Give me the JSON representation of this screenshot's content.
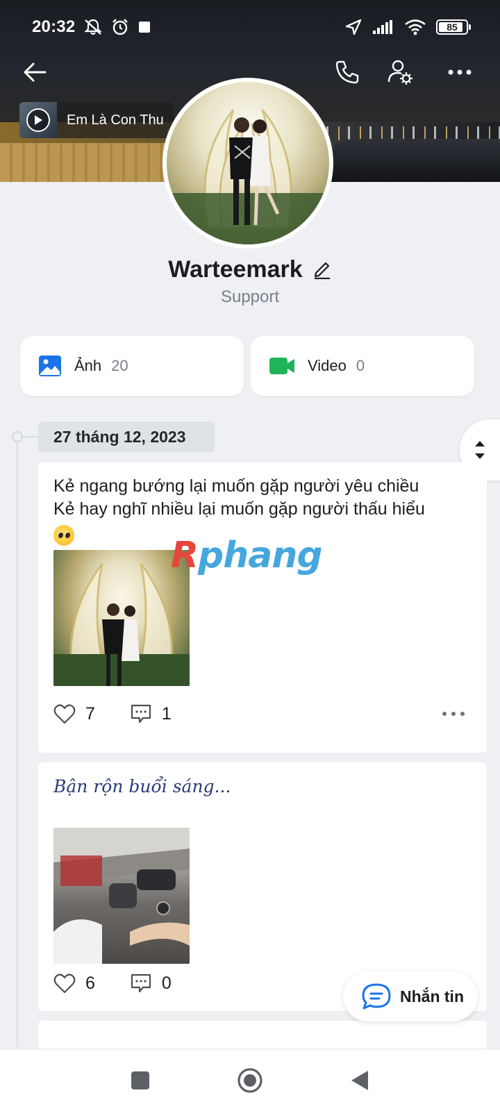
{
  "status_bar": {
    "time": "20:32",
    "battery": "85"
  },
  "music": {
    "title": "Em Là Con Thu"
  },
  "profile": {
    "name": "Warteemark",
    "status": "Support"
  },
  "media": {
    "photos": {
      "label": "Ảnh",
      "count": "20",
      "icon": "image-icon",
      "color": "#1a73e8"
    },
    "videos": {
      "label": "Video",
      "count": "0",
      "icon": "video-camera-icon",
      "color": "#1fb45a"
    }
  },
  "timeline": {
    "date": "27 tháng 12, 2023"
  },
  "posts": [
    {
      "text_line1": "Kẻ ngang bướng lại muốn gặp người yêu chiều",
      "text_line2": "Kẻ hay nghĩ nhiều lại muốn gặp người thấu hiểu",
      "emoji": "pleading-face",
      "likes": "7",
      "comments": "1"
    },
    {
      "title": "Bận rộn buổi sáng...",
      "likes": "6",
      "comments": "0"
    }
  ],
  "watermark": {
    "first": "R",
    "rest": "phang"
  },
  "message_button": {
    "label": "Nhắn tin"
  },
  "colors": {
    "accent": "#1a73e8",
    "background": "#eef0f3"
  }
}
